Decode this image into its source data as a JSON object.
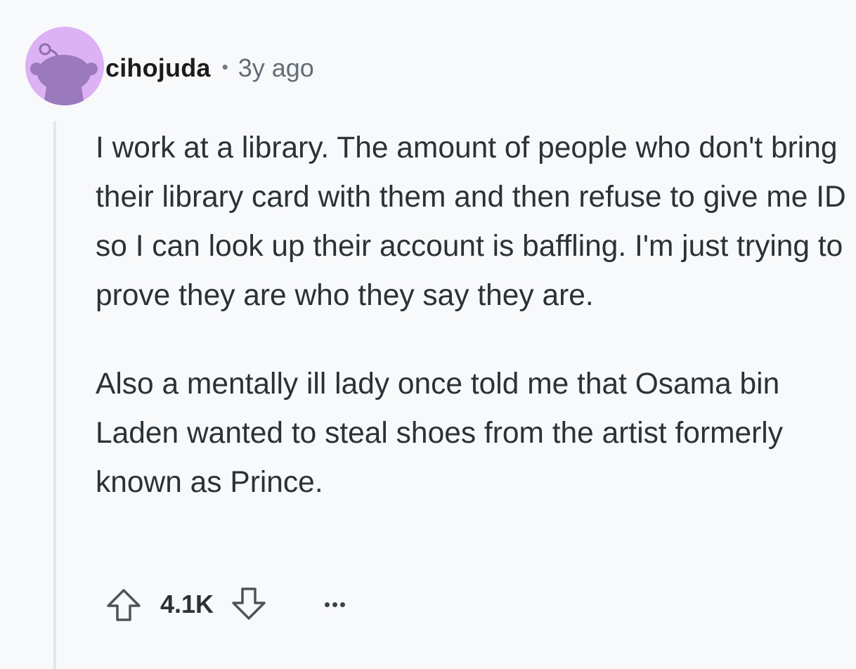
{
  "comment": {
    "author": "cihojuda",
    "separator": "•",
    "time_ago": "3y ago",
    "paragraphs": [
      "I work at a library. The amount of people who don't bring their library card with them and then refuse to give me ID so I can look up their account is baffling. I'm just trying to prove they are who they say they are.",
      "Also a mentally ill lady once told me that Osama bin Laden wanted to steal shoes from the artist formerly known as Prince."
    ]
  },
  "actions": {
    "upvote_icon": "arrow-up-outline-icon",
    "score": "4.1K",
    "downvote_icon": "arrow-down-outline-icon",
    "more_icon": "ellipsis-icon"
  },
  "colors": {
    "background": "#f8f9fb",
    "avatar_background": "#dcb2f4",
    "avatar_figure": "#9b79bd",
    "text": "#2a3236",
    "muted": "#646e76",
    "thread_line": "#e3e7ea"
  }
}
